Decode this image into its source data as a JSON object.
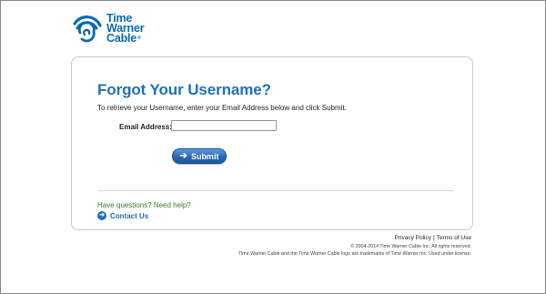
{
  "brand": {
    "name_line1": "Time",
    "name_line2": "Warner",
    "name_line3": "Cable",
    "registered": "®",
    "color": "#0b6ab3"
  },
  "form": {
    "title": "Forgot Your Username?",
    "instructions": "To retrieve your Username, enter your Email Address below and click Submit.",
    "email_label": "Email Address:",
    "email_value": "",
    "email_placeholder": "",
    "submit_label": "Submit",
    "submit_icon": "arrow-right-icon"
  },
  "help": {
    "question": "Have questions? Need help?",
    "contact_label": "Contact Us",
    "contact_icon": "arrow-right-circle-icon"
  },
  "footer": {
    "privacy_label": "Privacy Policy",
    "separator": "|",
    "terms_label": "Terms of Use",
    "copyright": "© 2004-2014 Time Warner Cable Inc. All rights reserved.",
    "trademark": "Time Warner Cable and the Time Warner Cable logo are trademarks of Time Warner Inc. Used under license."
  },
  "colors": {
    "title_blue": "#1f6fbf",
    "help_green": "#3f7a1e",
    "button_blue": "#2a67b8"
  }
}
